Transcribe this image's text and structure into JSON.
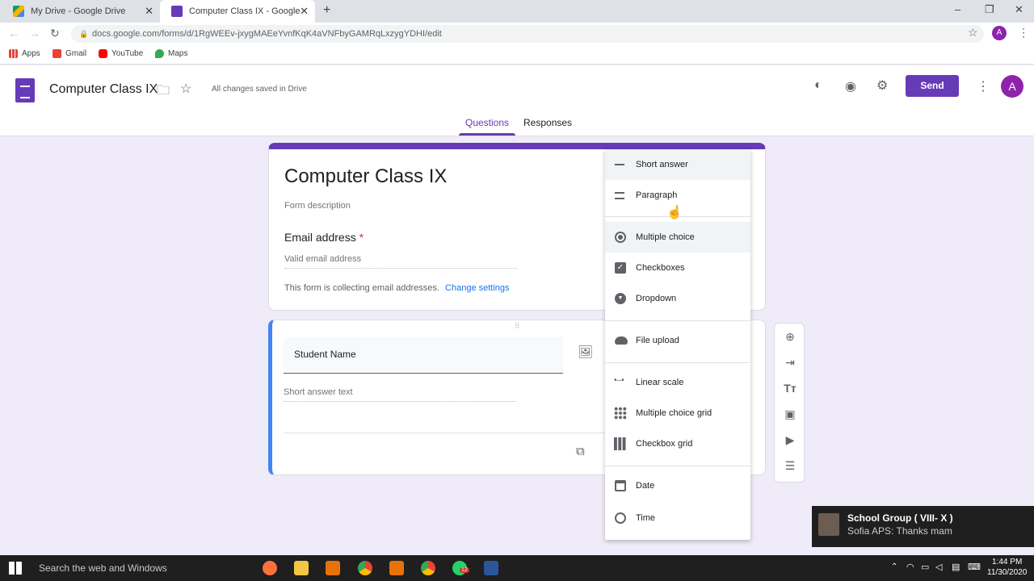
{
  "browser": {
    "tabs": [
      {
        "title": "My Drive - Google Drive",
        "active": false
      },
      {
        "title": "Computer Class IX - Google Forms",
        "active": true
      }
    ],
    "url": "docs.google.com/forms/d/1RgWEEv-jxygMAEeYvnfKqK4aVNFbyGAMRqLxzygYDHI/edit",
    "bookmarks": [
      "Apps",
      "Gmail",
      "YouTube",
      "Maps"
    ],
    "profile_initial": "A"
  },
  "forms_header": {
    "title": "Computer Class IX",
    "status": "All changes saved in Drive",
    "send_label": "Send",
    "avatar_initial": "A",
    "tabs": [
      "Questions",
      "Responses"
    ]
  },
  "form": {
    "title": "Computer Class IX",
    "description_placeholder": "Form description",
    "email_label": "Email address",
    "required_mark": "*",
    "email_placeholder": "Valid email address",
    "collecting_note": "This form is collecting email addresses.",
    "change_settings": "Change settings"
  },
  "question": {
    "title": "Student Name",
    "answer_placeholder": "Short answer text"
  },
  "type_menu": {
    "items": [
      {
        "label": "Short answer",
        "icon": "short-answer-icon"
      },
      {
        "label": "Paragraph",
        "icon": "paragraph-icon"
      },
      {
        "label": "Multiple choice",
        "icon": "radio-icon"
      },
      {
        "label": "Checkboxes",
        "icon": "checkbox-icon"
      },
      {
        "label": "Dropdown",
        "icon": "dropdown-icon"
      },
      {
        "label": "File upload",
        "icon": "cloud-upload-icon"
      },
      {
        "label": "Linear scale",
        "icon": "linear-scale-icon"
      },
      {
        "label": "Multiple choice grid",
        "icon": "grid-dots-icon"
      },
      {
        "label": "Checkbox grid",
        "icon": "grid-squares-icon"
      },
      {
        "label": "Date",
        "icon": "calendar-icon"
      },
      {
        "label": "Time",
        "icon": "clock-icon"
      }
    ],
    "highlighted": "Multiple choice"
  },
  "taskbar": {
    "search_placeholder": "Search the web and Windows",
    "time": "1:44 PM",
    "date": "11/30/2020",
    "chrome_badge": "12"
  },
  "notification": {
    "title": "School Group ( VIII- X )",
    "body": "Sofia APS: Thanks  mam"
  },
  "colors": {
    "brand": "#673ab7",
    "accent_blue": "#4285f4",
    "link": "#1a73e8",
    "required": "#d93025"
  }
}
